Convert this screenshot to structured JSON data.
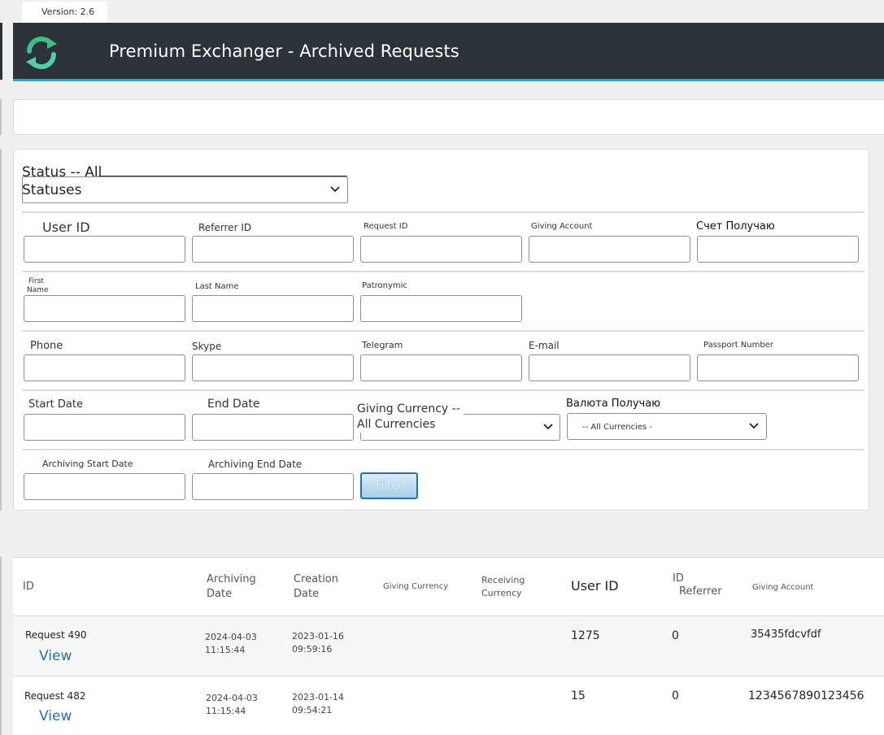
{
  "version": "Version: 2.6",
  "header": {
    "title": "Premium Exchanger - Archived Requests"
  },
  "filters": {
    "status_label_1": "Status",
    "status_label_2": "--",
    "status_label_3": "All",
    "status_value": "Statuses",
    "user_id": "User ID",
    "referrer_id": "Referrer ID",
    "request_id": "Request ID",
    "giving_account": "Giving Account",
    "receiving_account": "Счет Получаю",
    "first_name_1": "First",
    "first_name_2": "Name",
    "last_name": "Last Name",
    "patronymic": "Patronymic",
    "phone": "Phone",
    "skype": "Skype",
    "telegram": "Telegram",
    "email": "E-mail",
    "passport": "Passport Number",
    "start_date": "Start Date",
    "end_date": "End Date",
    "giving_currency_1": "Giving Currency --",
    "giving_currency_2": "All Currencies",
    "receiving_currency": "Валюта Получаю",
    "receiving_currency_value": "-- All Currencies -",
    "archiving_start": "Archiving Start Date",
    "archiving_end": "Archiving End Date",
    "filter_button": "Filter"
  },
  "table": {
    "headers": {
      "id": "ID",
      "archiving_date_1": "Archiving",
      "archiving_date_2": "Date",
      "creation_date_1": "Creation",
      "creation_date_2": "Date",
      "giving_currency": "Giving Currency",
      "receiving_currency_1": "Receiving",
      "receiving_currency_2": "Currency",
      "user_id": "User ID",
      "referrer_1": "ID",
      "referrer_2": "Referrer",
      "giving_account": "Giving Account"
    },
    "rows": [
      {
        "request": "Request 490",
        "view": "View",
        "arch_date": "2024-04-03",
        "arch_time": "11:15:44",
        "cr_date": "2023-01-16",
        "cr_time": "09:59:16",
        "user_id": "1275",
        "referrer": "0",
        "account": "35435fdcvfdf"
      },
      {
        "request": "Request 482",
        "view": "View",
        "arch_date": "2024-04-03",
        "arch_time": "11:15:44",
        "cr_date": "2023-01-14",
        "cr_time": "09:54:21",
        "user_id": "15",
        "referrer": "0",
        "account": "1234567890123456"
      }
    ]
  }
}
